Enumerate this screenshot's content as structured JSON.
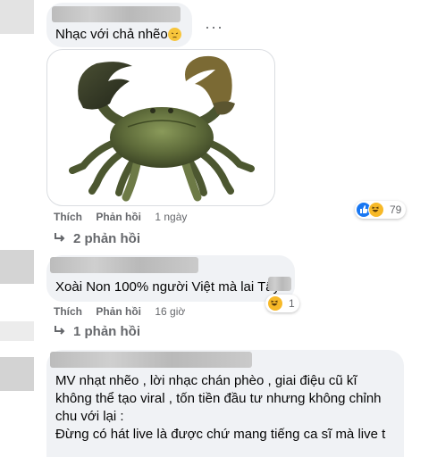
{
  "comments": [
    {
      "text": "Nhạc với chả nhẽo",
      "emoji": "pensive-face",
      "actions": {
        "like": "Thích",
        "reply": "Phản hồi",
        "time": "1 ngày"
      },
      "reaction_count": "79",
      "replies": "2 phản hồi",
      "more": "···"
    },
    {
      "text": "Xoài Non 100% người Việt mà lai Tây",
      "actions": {
        "like": "Thích",
        "reply": "Phản hồi",
        "time": "16 giờ"
      },
      "reaction_count": "1",
      "replies": "1 phản hồi"
    },
    {
      "lines": [
        "MV nhạt nhẽo , lời nhạc chán phèo , giai điệu cũ kĩ",
        "không thể tạo viral , tốn tiền đầu tư nhưng không chỉnh",
        "chu với lại :",
        "Đừng có hát live là được chứ mang tiếng ca sĩ mà live t"
      ]
    }
  ],
  "colors": {
    "bubble": "#f0f2f5",
    "meta": "#65676b",
    "like": "#1877f2",
    "haha": "#f7b928"
  }
}
